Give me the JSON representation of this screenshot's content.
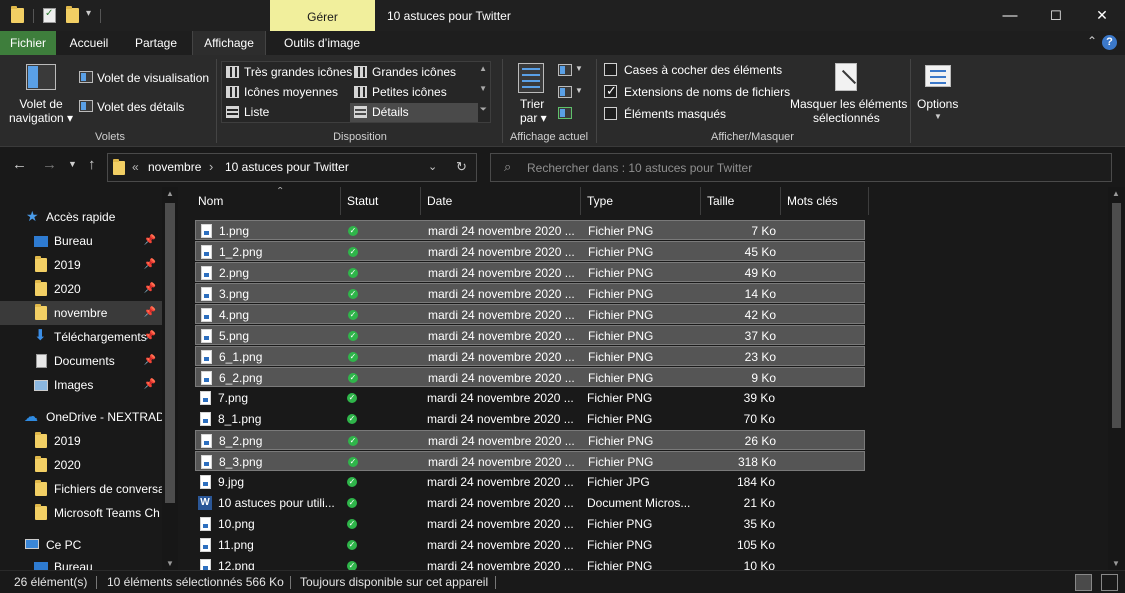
{
  "titlebar": {
    "context_tab": "Gérer",
    "title": "10 astuces pour Twitter",
    "minimize": "—",
    "maximize": "☐",
    "close": "✕"
  },
  "ribbon_tabs": {
    "fichier": "Fichier",
    "accueil": "Accueil",
    "partage": "Partage",
    "affichage": "Affichage",
    "outils_image": "Outils d’image",
    "help": "?"
  },
  "ribbon": {
    "volets": {
      "label": "Volets",
      "volet_navigation": [
        "Volet de",
        "navigation ▾"
      ],
      "volet_visualisation": "Volet de visualisation",
      "volet_details": "Volet des détails"
    },
    "disposition": {
      "label": "Disposition",
      "items": [
        "Très grandes icônes",
        "Grandes icônes",
        "Icônes moyennes",
        "Petites icônes",
        "Liste",
        "Détails"
      ]
    },
    "affichage_actuel": {
      "label": "Affichage actuel",
      "trier": [
        "Trier",
        "par ▾"
      ]
    },
    "afficher_masquer": {
      "label": "Afficher/Masquer",
      "cases": "Cases à cocher des éléments",
      "extensions": "Extensions de noms de fichiers",
      "masques": "Éléments masqués",
      "masquer": [
        "Masquer les éléments",
        "sélectionnés"
      ]
    },
    "options": "Options"
  },
  "address": {
    "sep1": "«",
    "crumb1": "novembre",
    "sep2": "›",
    "crumb2": "10 astuces pour Twitter",
    "search_placeholder": "Rechercher dans : 10 astuces pour Twitter"
  },
  "nav": [
    {
      "label": "Accès rapide",
      "icon": "star-icon"
    },
    {
      "label": "Bureau",
      "icon": "desktop-icon",
      "pinned": true
    },
    {
      "label": "2019",
      "icon": "folder-icon",
      "pinned": true
    },
    {
      "label": "2020",
      "icon": "folder-icon",
      "pinned": true
    },
    {
      "label": "novembre",
      "icon": "folder-icon",
      "pinned": true
    },
    {
      "label": "Téléchargements",
      "icon": "download-icon",
      "pinned": true
    },
    {
      "label": "Documents",
      "icon": "documents-icon",
      "pinned": true
    },
    {
      "label": "Images",
      "icon": "pictures-icon",
      "pinned": true
    },
    {
      "label": "OneDrive - NEXTRADI",
      "icon": "cloud-icon"
    },
    {
      "label": "2019",
      "icon": "folder-icon"
    },
    {
      "label": "2020",
      "icon": "folder-icon"
    },
    {
      "label": "Fichiers de conversa",
      "icon": "folder-icon"
    },
    {
      "label": "Microsoft Teams Ch",
      "icon": "folder-icon"
    },
    {
      "label": "Ce PC",
      "icon": "computer-icon"
    },
    {
      "label": "Bureau",
      "icon": "desktop-icon"
    }
  ],
  "columns": [
    "Nom",
    "Statut",
    "Date",
    "Type",
    "Taille",
    "Mots clés"
  ],
  "files": [
    {
      "name": "1.png",
      "date": "mardi 24 novembre 2020 ...",
      "type": "Fichier PNG",
      "size": "7 Ko",
      "selected": true
    },
    {
      "name": "1_2.png",
      "date": "mardi 24 novembre 2020 ...",
      "type": "Fichier PNG",
      "size": "45 Ko",
      "selected": true
    },
    {
      "name": "2.png",
      "date": "mardi 24 novembre 2020 ...",
      "type": "Fichier PNG",
      "size": "49 Ko",
      "selected": true
    },
    {
      "name": "3.png",
      "date": "mardi 24 novembre 2020 ...",
      "type": "Fichier PNG",
      "size": "14 Ko",
      "selected": true
    },
    {
      "name": "4.png",
      "date": "mardi 24 novembre 2020 ...",
      "type": "Fichier PNG",
      "size": "42 Ko",
      "selected": true
    },
    {
      "name": "5.png",
      "date": "mardi 24 novembre 2020 ...",
      "type": "Fichier PNG",
      "size": "37 Ko",
      "selected": true
    },
    {
      "name": "6_1.png",
      "date": "mardi 24 novembre 2020 ...",
      "type": "Fichier PNG",
      "size": "23 Ko",
      "selected": true
    },
    {
      "name": "6_2.png",
      "date": "mardi 24 novembre 2020 ...",
      "type": "Fichier PNG",
      "size": "9 Ko",
      "selected": true
    },
    {
      "name": "7.png",
      "date": "mardi 24 novembre 2020 ...",
      "type": "Fichier PNG",
      "size": "39 Ko",
      "selected": false
    },
    {
      "name": "8_1.png",
      "date": "mardi 24 novembre 2020 ...",
      "type": "Fichier PNG",
      "size": "70 Ko",
      "selected": false
    },
    {
      "name": "8_2.png",
      "date": "mardi 24 novembre 2020 ...",
      "type": "Fichier PNG",
      "size": "26 Ko",
      "selected": true
    },
    {
      "name": "8_3.png",
      "date": "mardi 24 novembre 2020 ...",
      "type": "Fichier PNG",
      "size": "318 Ko",
      "selected": true
    },
    {
      "name": "9.jpg",
      "date": "mardi 24 novembre 2020 ...",
      "type": "Fichier JPG",
      "size": "184 Ko",
      "selected": false
    },
    {
      "name": "10 astuces pour utili...",
      "date": "mardi 24 novembre 2020 ...",
      "type": "Document Micros...",
      "size": "21 Ko",
      "selected": false,
      "word": true
    },
    {
      "name": "10.png",
      "date": "mardi 24 novembre 2020 ...",
      "type": "Fichier PNG",
      "size": "35 Ko",
      "selected": false
    },
    {
      "name": "11.png",
      "date": "mardi 24 novembre 2020 ...",
      "type": "Fichier PNG",
      "size": "105 Ko",
      "selected": false
    },
    {
      "name": "12.png",
      "date": "mardi 24 novembre 2020 ...",
      "type": "Fichier PNG",
      "size": "10 Ko",
      "selected": false
    }
  ],
  "statusbar": {
    "count": "26 élément(s)",
    "selection": "10 éléments sélectionnés  566 Ko",
    "availability": "Toujours disponible sur cet appareil"
  },
  "colors": {
    "accent_green": "#3e7e3c",
    "context_tab": "#f1ef9c",
    "selection": "#555555",
    "status_ok": "#2fb54a"
  }
}
